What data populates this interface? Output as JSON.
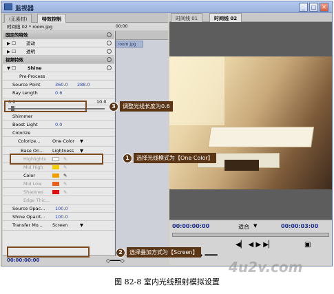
{
  "window": {
    "title": "监视器",
    "min": "_",
    "max": "□",
    "close": "✕"
  },
  "left_tabs": [
    "(无素材)",
    "特效控制"
  ],
  "clip_path": "时间线 02 * room.jpg",
  "timeline_time": "00:00",
  "timeline_clip": "room.jpg",
  "fixed_effects": "固定的特效",
  "motion": "运动",
  "opacity": "透明",
  "video_effects": "视频特效",
  "shine": "Shine",
  "pre_process": "Pre-Process",
  "source_point": {
    "label": "Source Point",
    "x": "360.0",
    "y": "288.0"
  },
  "ray_length": {
    "label": "Ray Length",
    "value": "0.6"
  },
  "slider_min": "0.0",
  "slider_max": "10.0",
  "shimmer": "Shimmer",
  "boost_light": {
    "label": "Boost Light",
    "value": "0.0"
  },
  "colorize_section": "Colorize",
  "colorize": {
    "label": "Colorize...",
    "value": "One Color"
  },
  "base_on": {
    "label": "Base On...",
    "value": "Lightness"
  },
  "color_rows": [
    {
      "label": "Highlights",
      "color": "#ffffff"
    },
    {
      "label": "Mid High",
      "color": "#f5d000"
    },
    {
      "label": "Color",
      "color": "#f2a000"
    },
    {
      "label": "Mid Low",
      "color": "#e8601a"
    },
    {
      "label": "Shadows",
      "color": "#e01010"
    }
  ],
  "edge_thickness": "Edge Thic...",
  "source_opacity": {
    "label": "Source Opac...",
    "value": "100.0"
  },
  "shine_opacity": {
    "label": "Shine Opacit...",
    "value": "100.0"
  },
  "transfer_mode": {
    "label": "Transfer Mo...",
    "value": "Screen"
  },
  "bottom_time": "00:00:00:00",
  "right_tabs": [
    "时间线 01",
    "时间线 02"
  ],
  "monitor_time_left": "00:00:00:00",
  "fit_label": "适合",
  "monitor_time_right": "00:00:03:00",
  "callouts": [
    {
      "num": "3",
      "text": "调整光线长度为0.6"
    },
    {
      "num": "1",
      "text": "选择光线模式为【One Color】"
    },
    {
      "num": "2",
      "text": "选择叠加方式为【Screen】"
    }
  ],
  "watermark": "4u2v.com",
  "caption": "图 82-8   室内光线照射模拟设置"
}
